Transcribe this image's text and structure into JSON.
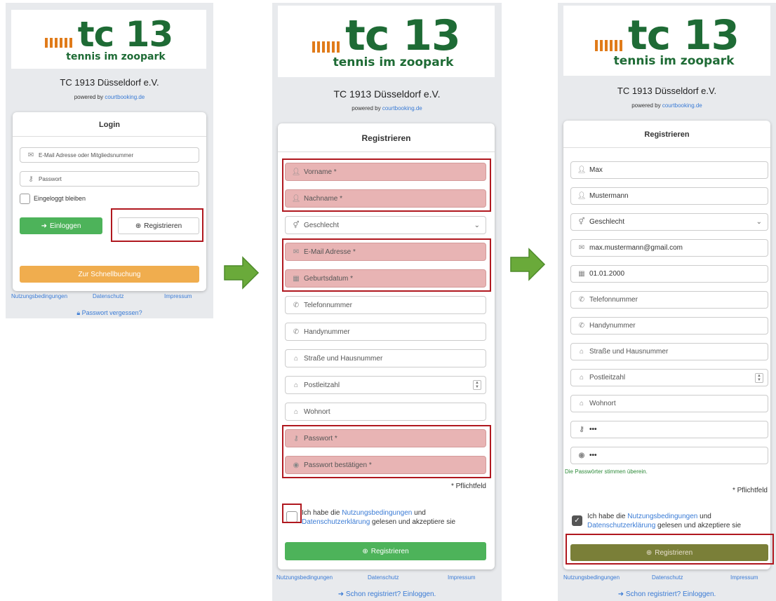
{
  "logo": {
    "tc": "tc 13",
    "sub": "tennis im zoopark"
  },
  "club": "TC 1913 Düsseldorf e.V.",
  "powered": {
    "prefix": "powered by ",
    "link": "courtbooking.de"
  },
  "login": {
    "title": "Login",
    "email_placeholder": "E-Mail Adresse oder Mitgliedsnummer",
    "password_placeholder": "Passwort",
    "remember": "Eingeloggt bleiben",
    "login_button": "Einloggen",
    "register_button": "Registrieren",
    "quick_button": "Zur Schnellbuchung",
    "forgot": "Passwort vergessen?"
  },
  "footer": {
    "terms": "Nutzungsbedingungen",
    "privacy": "Datenschutz",
    "imprint": "Impressum"
  },
  "register": {
    "title": "Registrieren",
    "fields": {
      "firstname": "Vorname *",
      "lastname": "Nachname *",
      "gender": "Geschlecht",
      "email": "E-Mail Adresse *",
      "birthdate": "Geburtsdatum *",
      "phone": "Telefonnummer",
      "mobile": "Handynummer",
      "street": "Straße und Hausnummer",
      "zip": "Postleitzahl",
      "city": "Wohnort",
      "password": "Passwort *",
      "password_confirm": "Passwort bestätigen *"
    },
    "required_note": "* Pflichtfeld",
    "terms_pre": "Ich habe die ",
    "terms_link1": "Nutzungsbedingungen",
    "terms_mid": " und ",
    "terms_link2": "Datenschutzerklärung",
    "terms_post": " gelesen und akzeptiere sie",
    "register_button": "Registrieren",
    "login_link": "Schon registriert? Einloggen."
  },
  "filled": {
    "firstname": "Max",
    "lastname": "Mustermann",
    "gender": "Geschlecht",
    "email": "max.mustermann@gmail.com",
    "birthdate": "01.01.2000",
    "phone": "Telefonnummer",
    "mobile": "Handynummer",
    "street": "Straße und Hausnummer",
    "zip": "Postleitzahl",
    "city": "Wohnort",
    "password": "•••",
    "password_confirm": "•••",
    "match_message": "Die Passwörter stimmen überein.",
    "terms_pre": "Ich habe die ",
    "terms_post_line2": " gelesen und akzeptiere sie"
  },
  "colors": {
    "green": "#4db35a",
    "orange": "#f0ad4e",
    "olive": "#7a7f38",
    "highlight": "#b0181f",
    "logo_green": "#1e6b35",
    "logo_orange": "#e07b1a",
    "arrow": "#6aaa3a"
  }
}
